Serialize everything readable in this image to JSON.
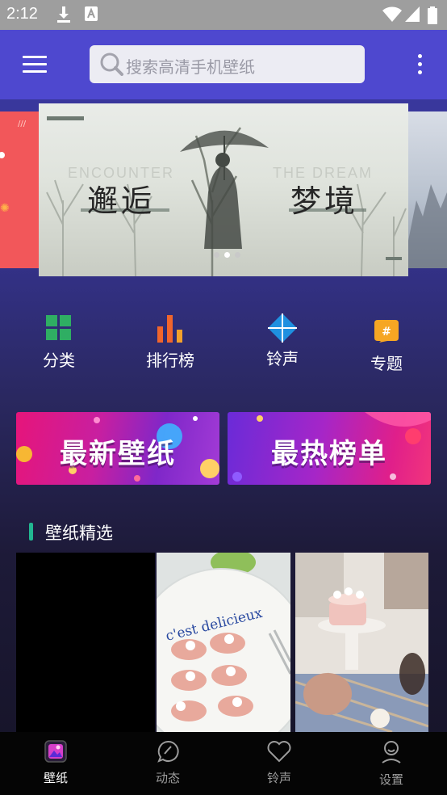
{
  "status_bar": {
    "time": "2:12",
    "icons": [
      "download-icon",
      "text-notification-icon",
      "wifi-icon",
      "signal-icon",
      "battery-icon"
    ]
  },
  "header": {
    "search_placeholder": "搜索高清手机壁纸",
    "accent_color": "#4e48cf"
  },
  "banner": {
    "title_left": "邂逅",
    "title_right": "梦境",
    "subtitle_left": "ENCOUNTER",
    "subtitle_right": "THE DREAM",
    "page_count": 3,
    "active_page": 1
  },
  "categories": [
    {
      "label": "分类",
      "icon": "grid-icon"
    },
    {
      "label": "排行榜",
      "icon": "bar-chart-icon"
    },
    {
      "label": "铃声",
      "icon": "diamond-icon"
    },
    {
      "label": "专题",
      "icon": "hashtag-icon"
    }
  ],
  "promos": [
    {
      "label": "最新壁纸"
    },
    {
      "label": "最热榜单"
    }
  ],
  "section": {
    "title": "壁纸精选"
  },
  "featured": [
    {
      "caption": ""
    },
    {
      "caption": "c'est delicieux"
    },
    {
      "caption": ""
    }
  ],
  "bottom_nav": [
    {
      "label": "壁纸",
      "icon": "wallpaper-icon",
      "active": true
    },
    {
      "label": "动态",
      "icon": "chat-bubble-icon",
      "active": false
    },
    {
      "label": "铃声",
      "icon": "heart-icon",
      "active": false
    },
    {
      "label": "设置",
      "icon": "user-icon",
      "active": false
    }
  ]
}
